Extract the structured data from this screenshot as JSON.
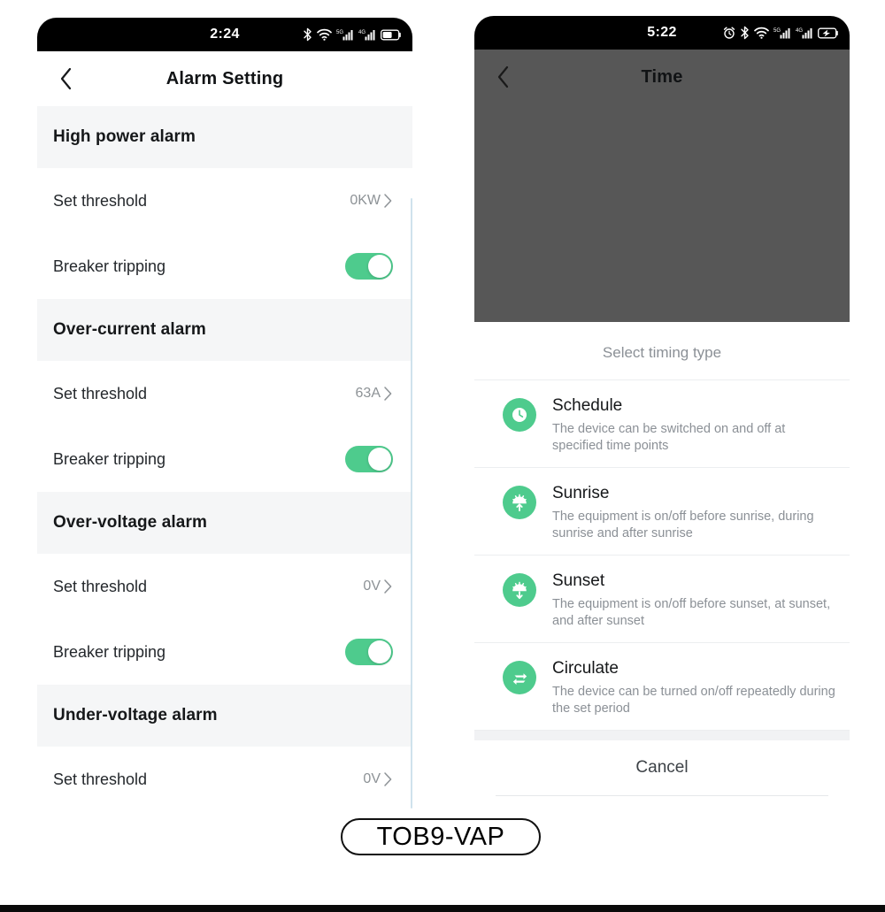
{
  "left_phone": {
    "status_bar": {
      "time": "2:24",
      "icons": [
        "bluetooth-icon",
        "wifi-icon",
        "signal-5g-icon",
        "signal-4g-icon",
        "battery-icon"
      ]
    },
    "nav": {
      "back_icon": "chevron-left-icon",
      "title": "Alarm Setting"
    },
    "groups": [
      {
        "header": "High power alarm",
        "rows": [
          {
            "label": "Set threshold",
            "value": "0KW",
            "type": "link",
            "chevron": "chevron-right-icon"
          },
          {
            "label": "Breaker tripping",
            "type": "toggle",
            "toggle_on": true
          }
        ]
      },
      {
        "header": "Over-current alarm",
        "rows": [
          {
            "label": "Set threshold",
            "value": "63A",
            "type": "link",
            "chevron": "chevron-right-icon"
          },
          {
            "label": "Breaker tripping",
            "type": "toggle",
            "toggle_on": true
          }
        ]
      },
      {
        "header": "Over-voltage alarm",
        "rows": [
          {
            "label": "Set threshold",
            "value": "0V",
            "type": "link",
            "chevron": "chevron-right-icon"
          },
          {
            "label": "Breaker tripping",
            "type": "toggle",
            "toggle_on": true
          }
        ]
      },
      {
        "header": "Under-voltage alarm",
        "rows": [
          {
            "label": "Set threshold",
            "value": "0V",
            "type": "link",
            "chevron": "chevron-right-icon"
          }
        ]
      }
    ]
  },
  "right_phone": {
    "status_bar": {
      "time": "5:22",
      "icons": [
        "alarm-clock-icon",
        "bluetooth-icon",
        "wifi-icon",
        "signal-5g-icon",
        "signal-4g-icon",
        "battery-charging-icon"
      ]
    },
    "nav": {
      "back_icon": "chevron-left-icon",
      "title": "Time"
    },
    "sheet": {
      "title": "Select timing type",
      "options": [
        {
          "icon": "clock-icon",
          "title": "Schedule",
          "desc": "The device can be switched on and off at specified time points"
        },
        {
          "icon": "sunrise-icon",
          "title": "Sunrise",
          "desc": "The equipment is on/off before sunrise, during sunrise and after sunrise"
        },
        {
          "icon": "sunset-icon",
          "title": "Sunset",
          "desc": "The equipment is on/off before sunset, at sunset, and after sunset"
        },
        {
          "icon": "circulate-icon",
          "title": "Circulate",
          "desc": "The device can be turned on/off repeatedly during the set period"
        }
      ],
      "cancel_label": "Cancel"
    }
  },
  "footer": {
    "model_label": "TOB9-VAP"
  },
  "colors": {
    "accent_green": "#4ecb8d",
    "group_header_bg": "#f5f6f7",
    "dim_overlay": "#575757",
    "status_bar_bg": "#000000",
    "muted_text": "#8b9096"
  }
}
